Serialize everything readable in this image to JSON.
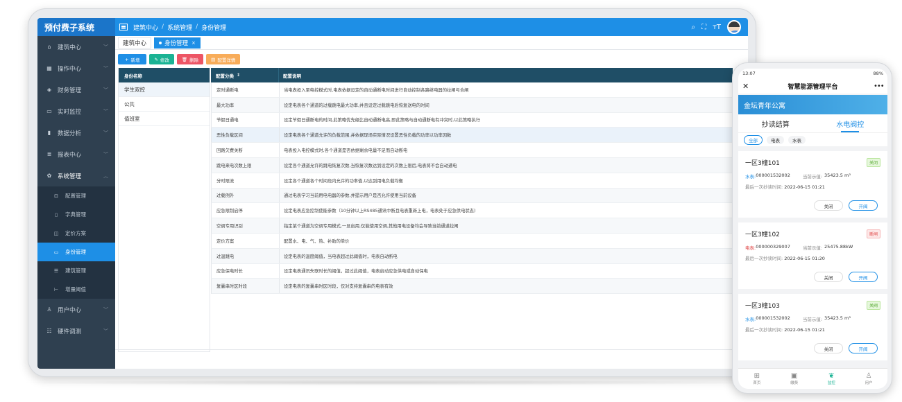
{
  "app": {
    "brand": "预付费子系统"
  },
  "breadcrumb": [
    "建筑中心",
    "系统管理",
    "身份管理"
  ],
  "topbar_icons": [
    "search-icon",
    "fullscreen-icon",
    "font-size-icon",
    "avatar"
  ],
  "sidebar": {
    "items": [
      {
        "label": "建筑中心",
        "icon": "home-icon",
        "glyph": "⌂"
      },
      {
        "label": "操作中心",
        "icon": "grid-icon",
        "glyph": "▦"
      },
      {
        "label": "财务管理",
        "icon": "finance-icon",
        "glyph": "◈"
      },
      {
        "label": "实时监控",
        "icon": "monitor-icon",
        "glyph": "▭"
      },
      {
        "label": "数据分析",
        "icon": "bar-chart-icon",
        "glyph": "▮"
      },
      {
        "label": "报表中心",
        "icon": "database-icon",
        "glyph": "≣"
      },
      {
        "label": "系统管理",
        "icon": "gear-icon",
        "glyph": "✿"
      }
    ],
    "sub_items": [
      {
        "label": "配置管理",
        "glyph": "⊡"
      },
      {
        "label": "字典管理",
        "glyph": "▯"
      },
      {
        "label": "定价方案",
        "glyph": "◫"
      },
      {
        "label": "身份管理",
        "glyph": "▭"
      },
      {
        "label": "建筑管理",
        "glyph": "☰"
      },
      {
        "label": "增量阈值",
        "glyph": "⊢"
      }
    ],
    "bottom_items": [
      {
        "label": "用户中心",
        "glyph": "♙"
      },
      {
        "label": "硬件调测",
        "glyph": "☷"
      }
    ]
  },
  "tabs": [
    {
      "label": "建筑中心"
    },
    {
      "label": "身份管理"
    }
  ],
  "toolbar": {
    "add": "新增",
    "edit": "修改",
    "delete": "删除",
    "config": "配置详情"
  },
  "identity": {
    "header": "身份名称",
    "rows": [
      "学生双控",
      "公共",
      "值班室"
    ]
  },
  "config": {
    "headers": [
      "配置分类",
      "配置说明"
    ],
    "rows": [
      [
        "定时通断电",
        "当电表投入至电控模式时,电表依据设定的自动通断电时间进行自动控制各路继电器的拉闸与合闸"
      ],
      [
        "最大功率",
        "设定电表各个通道的过载跳电最大功率,并且设定过载跳电后恢复送电的时间"
      ],
      [
        "节假日通电",
        "设定节假日通断电的时间,此策略优先级比自动通断电高,即此策略与自动通断电有冲突时,以此策略执行"
      ],
      [
        "恶性负载区间",
        "设定电表各个通道允许的负载范围,并依据现场实际情况设置恶性负载的功率以功率因数"
      ],
      [
        "回路欠费关断",
        "电表投入电控模式时,各个通道是否依据剩余电量不足而自动断电"
      ],
      [
        "跳电来电次数上限",
        "设定各个通道允许的跳电恢复次数,当恢复次数达到设定的次数上限后,电表将不会自动通电"
      ],
      [
        "分时限流",
        "设定各个通道各个时间段内允许的功率值,以达到用电负载均衡"
      ],
      [
        "过载例外",
        "通过电表学习当前用电电器的参数,并提示用户是否允许使用当前设备"
      ],
      [
        "应急限制启停",
        "设定电表应急控制使能参数（10分钟以上RS485通讯中断且电表重新上电，电表处于应急供电状态)"
      ],
      [
        "空调专用识别",
        "指定某个通道为空调专用模式,一旦启用,仅能使用空调,其他用电设备均会导致当前通道拉闸"
      ],
      [
        "定价方案",
        "配置水、电、气、热、补助的单价"
      ],
      [
        "过温跳电",
        "设定电表的温度阈值，当电表超过此阈值时，电表自动断电"
      ],
      [
        "应急保电时长",
        "设定电表通讯失联时长的阈值，超过此阈值，电表启动应急供电或自动保电"
      ],
      [
        "复囊串时区时段",
        "设定电表的复囊串时区时段，仅对支持复囊串的电表有效"
      ]
    ]
  },
  "phone": {
    "status_time": "13:07",
    "status_right": "88%",
    "title": "智慧能源管理平台",
    "banner": "金坛青年公寓",
    "tabs": [
      "抄读结算",
      "水电阀控"
    ],
    "filters": [
      "全部",
      "电表",
      "水表"
    ],
    "cards": [
      {
        "title": "一区3幢101",
        "badge": "关闭",
        "meter_label": "水表:",
        "meter_no": "000001532002",
        "current_label": "当前示值:",
        "current": "35423.5 m³",
        "time_label": "最后一次抄读时间:",
        "time": "2022-06-15 01:21",
        "btn_close": "关闭",
        "btn_open": "开阀"
      },
      {
        "title": "一区3幢102",
        "badge": "断闸",
        "meter_label": "电表:",
        "meter_no": "000000329007",
        "current_label": "当前示值:",
        "current": "25475.88kW",
        "time_label": "最后一次抄读时间:",
        "time": "2022-06-15 01:20",
        "btn_close": "关闭",
        "btn_open": "开阀"
      },
      {
        "title": "一区3幢103",
        "badge": "关阀",
        "meter_label": "水表:",
        "meter_no": "000001532002",
        "current_label": "当前示值:",
        "current": "35423.5 m³",
        "time_label": "最后一次抄读时间:",
        "time": "2022-06-15 01:21",
        "btn_close": "关闭",
        "btn_open": "开阀"
      }
    ],
    "bottom_nav": [
      "首页",
      "缴费",
      "监控",
      "用户"
    ]
  }
}
